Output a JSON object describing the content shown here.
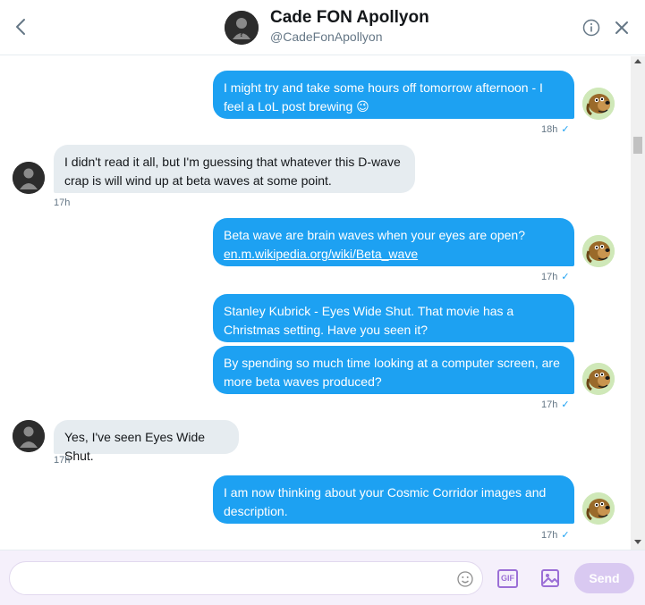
{
  "header": {
    "name": "Cade FON Apollyon",
    "handle": "@CadeFonApollyon"
  },
  "messages": [
    {
      "text": "I might try and take some hours off tomorrow afternoon - I feel a LoL post brewing 😉",
      "time": "18h"
    },
    {
      "text": "I didn't read it all, but I'm guessing that whatever this D-wave crap is will wind up at beta waves at some point.",
      "time": "17h"
    },
    {
      "text": "Beta wave are brain waves when your eyes are open?",
      "link": "en.m.wikipedia.org/wiki/Beta_wave",
      "time": "17h"
    },
    {
      "text": "Stanley Kubrick - Eyes Wide Shut. That movie has a Christmas setting. Have you seen it?"
    },
    {
      "text": "By spending so much time looking at a computer screen, are more beta waves produced?",
      "time": "17h"
    },
    {
      "text": "Yes, I've seen Eyes Wide Shut.",
      "time": "17h"
    },
    {
      "text": "I am now thinking about your Cosmic Corridor images and description.",
      "time": "17h"
    }
  ],
  "composer": {
    "placeholder": "",
    "gif_label": "GIF",
    "send_label": "Send"
  },
  "colors": {
    "outgoing_bubble": "#1da1f2",
    "incoming_bubble": "#e6ecf0",
    "composer_accent": "#9b6fd6",
    "send_disabled": "#d9c9f1"
  },
  "icons": [
    "back-arrow-icon",
    "info-icon",
    "close-icon",
    "emoji-icon",
    "gif-icon",
    "image-icon",
    "check-icon"
  ]
}
